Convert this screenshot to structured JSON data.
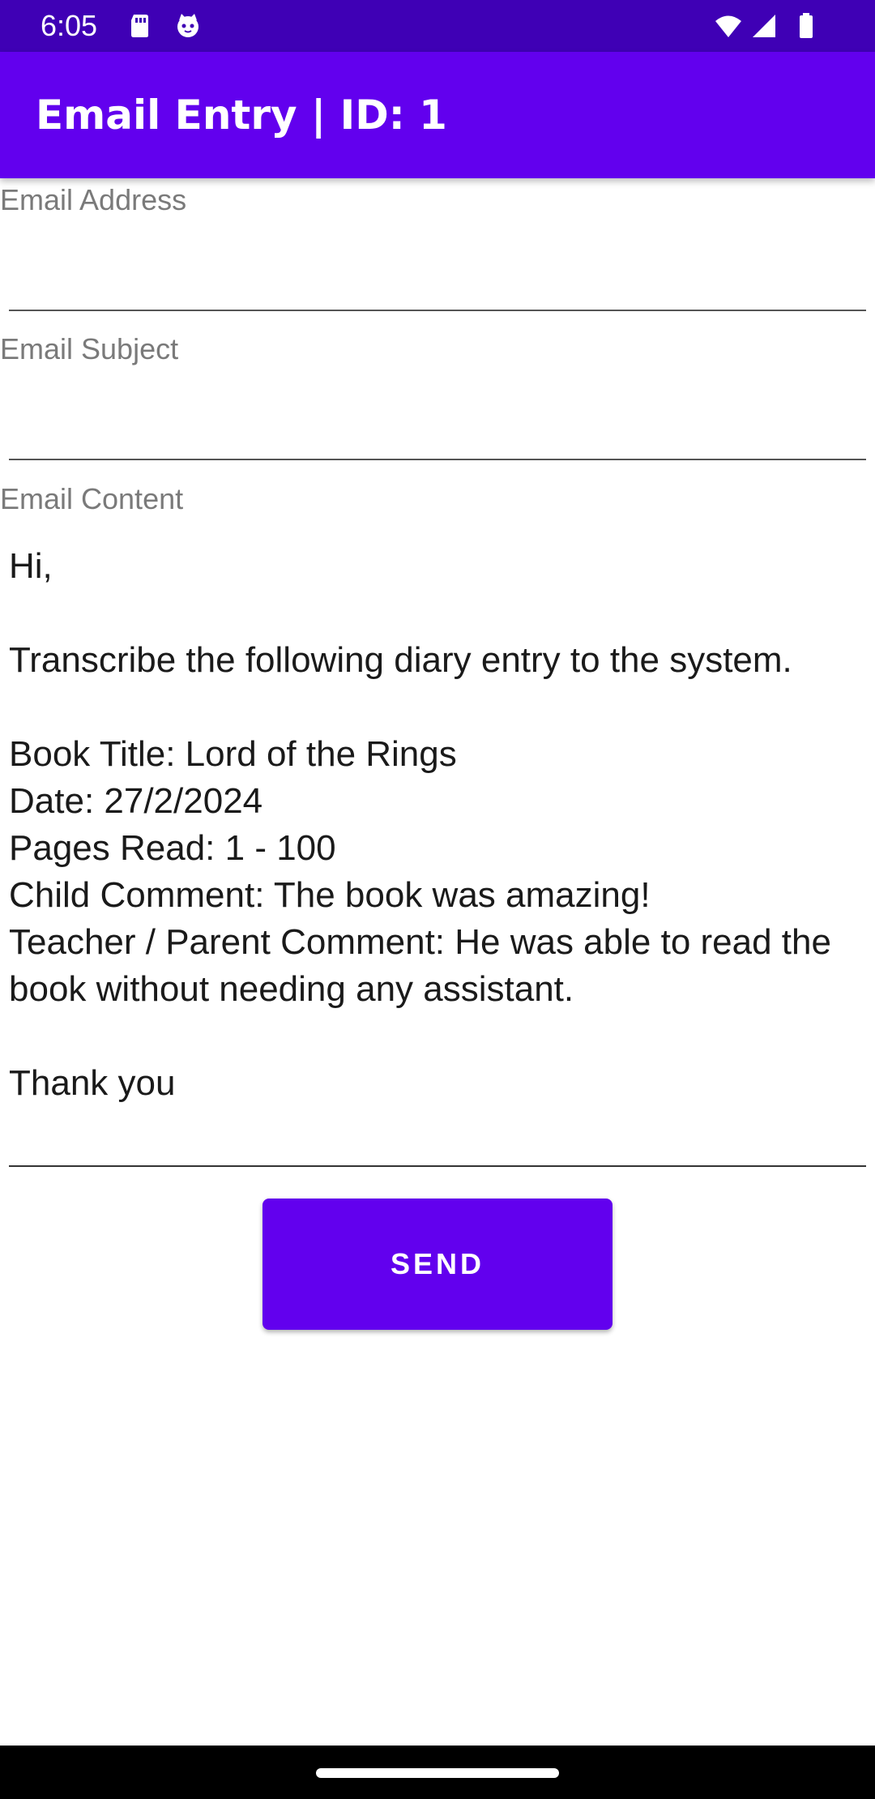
{
  "status_bar": {
    "time": "6:05",
    "icons": [
      "sd-card-icon",
      "cat-icon",
      "wifi-icon",
      "signal-icon",
      "battery-icon"
    ]
  },
  "app_bar": {
    "title": "Email Entry | ID: 1"
  },
  "form": {
    "address": {
      "label": "Email Address",
      "value": ""
    },
    "subject": {
      "label": "Email Subject",
      "value": ""
    },
    "content": {
      "label": "Email Content",
      "value": "Hi,\n\nTranscribe the following diary entry to the system.\n\nBook Title: Lord of the Rings\nDate: 27/2/2024\nPages Read: 1 - 100\nChild Comment: The book was amazing!\nTeacher / Parent Comment: He was able to read the book without needing any assistant.\n\nThank you"
    },
    "send_label": "SEND"
  },
  "colors": {
    "status_bar": "#3f00b5",
    "app_bar": "#6200ee",
    "button": "#6200ee"
  }
}
